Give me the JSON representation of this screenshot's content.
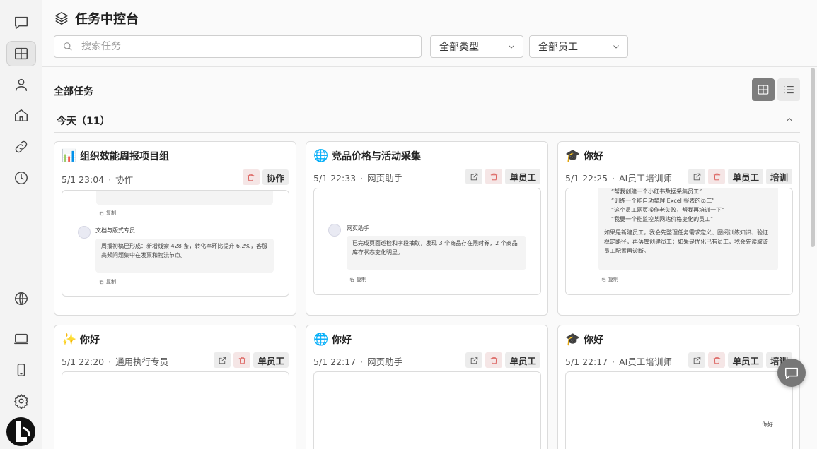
{
  "header": {
    "title": "任务中控台",
    "search_placeholder": "搜索任务",
    "type_filter": "全部类型",
    "staff_filter": "全部员工"
  },
  "main": {
    "section_title": "全部任务",
    "group_label": "今天（11）"
  },
  "cards": [
    {
      "emoji": "📊",
      "title": "组织效能周报项目组",
      "time": "5/1 23:04",
      "role": "协作",
      "tags": [
        "协作"
      ],
      "preview": {
        "copy_label": "复制",
        "agent_name": "文档与版式专员",
        "message": "周报初稿已形成：新增线索 428 条，转化率环比提升 6.2%，客服高频问题集中在发票和物流节点。"
      }
    },
    {
      "emoji": "🌐",
      "title": "竞品价格与活动采集",
      "time": "5/1 22:33",
      "role": "网页助手",
      "tags": [
        "单员工"
      ],
      "preview": {
        "copy_label": "复制",
        "agent_name": "网页助手",
        "message": "已完成页面巡检和字段抽取，发现 3 个商品存在限时券，2 个商品库存状态变化明显。"
      }
    },
    {
      "emoji": "🎓",
      "title": "你好",
      "time": "5/1 22:25",
      "role": "AI员工培训师",
      "tags": [
        "单员工",
        "培训"
      ],
      "preview": {
        "copy_label": "复制",
        "bullets": [
          "“帮我创建一个小红书数据采集员工”",
          "“训练一个能自动整理 Excel 报表的员工”",
          "“这个员工网页操作老失败，帮我再培训一下”",
          "“我要一个能监控某网站价格变化的员工”"
        ],
        "message": "如果是新建员工，我会先整理任务需求定义、圈阅训练知识、验证稳定路径，再落库创建员工；如果是优化已有员工，我会先读取该员工配置再诊断。"
      }
    },
    {
      "emoji": "✨",
      "title": "你好",
      "time": "5/1 22:20",
      "role": "通用执行专员",
      "tags": [
        "单员工"
      ]
    },
    {
      "emoji": "🌐",
      "title": "你好",
      "time": "5/1 22:17",
      "role": "网页助手",
      "tags": [
        "单员工"
      ]
    },
    {
      "emoji": "🎓",
      "title": "你好",
      "time": "5/1 22:17",
      "role": "AI员工培训师",
      "tags": [
        "单员工",
        "培训"
      ],
      "preview": {
        "user_message": "你好"
      }
    }
  ],
  "icons": {
    "sidebar": [
      "chat-icon",
      "dashboard-icon",
      "user-icon",
      "home-icon",
      "link-icon",
      "history-icon",
      "globe-icon",
      "monitor-icon",
      "phone-icon",
      "settings-icon"
    ],
    "card_actions": [
      "open-external-icon",
      "trash-icon"
    ]
  },
  "colors": {
    "delete_red": "#d9534f",
    "active_toggle": "#7d7d7d"
  }
}
